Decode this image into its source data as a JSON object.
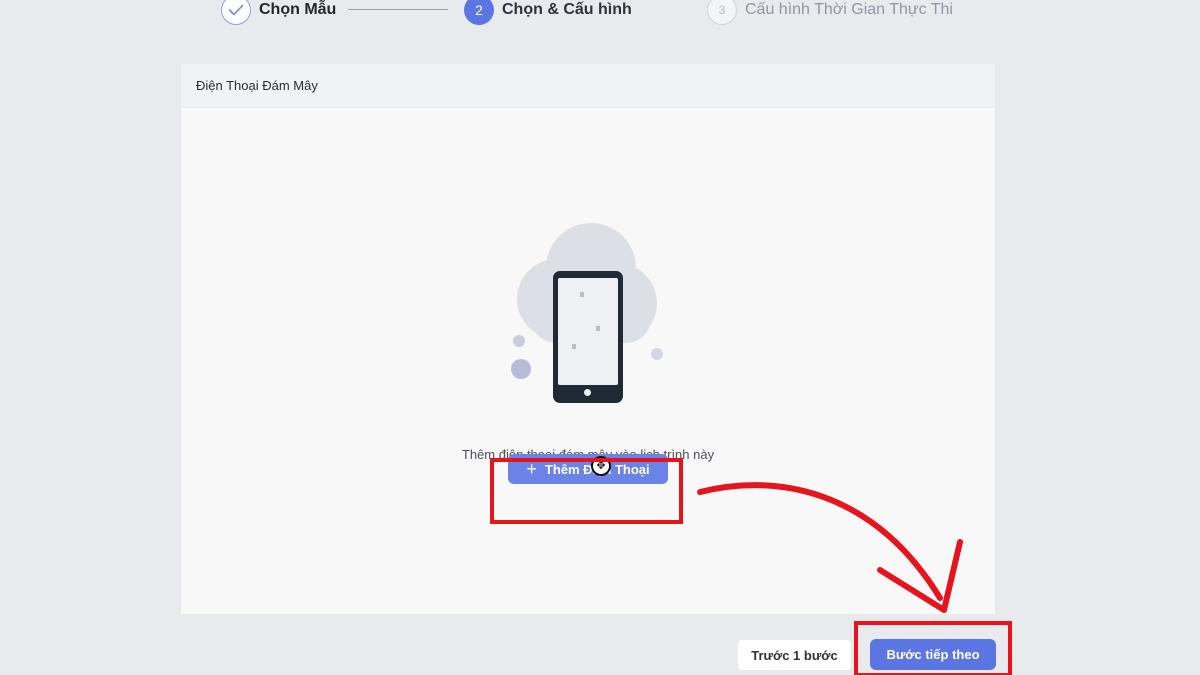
{
  "stepper": {
    "steps": [
      {
        "number": "✓",
        "label": "Chọn Mẫu",
        "state": "done"
      },
      {
        "number": "2",
        "label": "Chọn & Cấu hình",
        "state": "active"
      },
      {
        "number": "3",
        "label": "Cấu hình Thời Gian Thực Thi",
        "state": "pending"
      }
    ]
  },
  "panel": {
    "title": "Điện Thoại Đám Mây",
    "empty_hint": "Thêm điện thoại đám mây vào lịch trình này",
    "add_button": {
      "icon": "plus-icon",
      "label": "Thêm Điện Thoại"
    }
  },
  "footer": {
    "prev_label": "Trước 1 bước",
    "next_label": "Bước tiếp theo"
  },
  "colors": {
    "primary": "#5b76e3",
    "annotation_red": "#e5141d",
    "background": "#e9eaed"
  }
}
